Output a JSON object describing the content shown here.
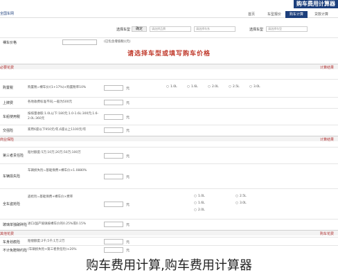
{
  "header": {
    "title": "购车费用计算器"
  },
  "nav": {
    "logo": "全国车网",
    "tabs": [
      "首页",
      "车型报价",
      "购车计算",
      "贷款计算"
    ]
  },
  "search": {
    "label_brand": "选择车型",
    "sel1": "请选择品牌",
    "sel2": "请选择车系",
    "sel3": "请选择车型",
    "btn1": "选择车型",
    "btn2": "确定"
  },
  "form": {
    "price_label": "裸车价格",
    "price_hint": "(已包含增值税)(元)",
    "notice": "请选择车型或填写购车价格"
  },
  "sections": {
    "must": {
      "left": "必要花费",
      "right": "计算结果"
    },
    "insurance": {
      "left": "商业保险",
      "right": "计算结果"
    },
    "extra": {
      "left": "其他花费",
      "right": "购车花费"
    }
  },
  "must_rows": [
    {
      "label": "购置税",
      "text": "购置税=裸车价/(1+17%)×购置税率10%",
      "unit": "元"
    },
    {
      "label": "上牌费",
      "text": "各地收费标准不同,一般为500元",
      "unit": "元"
    },
    {
      "label": "车船使用税",
      "text": "按排量收取:1.0L以下:180元;1.0-1.6L:300元;1.6-2.0L:360元",
      "unit": "元"
    },
    {
      "label": "交强险",
      "text": "家用6座以下950元/年,6座以上1100元/年",
      "unit": "元"
    }
  ],
  "displacement_options": [
    "1.0L",
    "1.6L",
    "2.0L",
    "2.5L",
    "3.0L"
  ],
  "insurance_rows": [
    {
      "label": "第三者责任险",
      "text": "赔付额度:5万;10万;20万;50万;100万",
      "unit": "元"
    },
    {
      "label": "车辆损失险",
      "text": "车辆损失险=基础保费+裸车价×1.0880%",
      "unit": "元"
    },
    {
      "label": "全车盗抢险",
      "text": "盗抢险=基础保费+裸车价×费率",
      "unit": "元"
    },
    {
      "label": "玻璃单独破碎险",
      "text": "进口/国产玻璃按裸车价的0.25%或0.15%",
      "unit": "元"
    }
  ],
  "extra_rows": [
    {
      "label": "车身划痕险",
      "text": "赔偿额度:2千;5千;1万;2万",
      "unit": "元"
    },
    {
      "label": "不计免赔特约险",
      "text": "(车辆损失险+第三者责任险)×20%",
      "unit": "元"
    }
  ],
  "caption": "购车费用计算,购车费用计算器"
}
